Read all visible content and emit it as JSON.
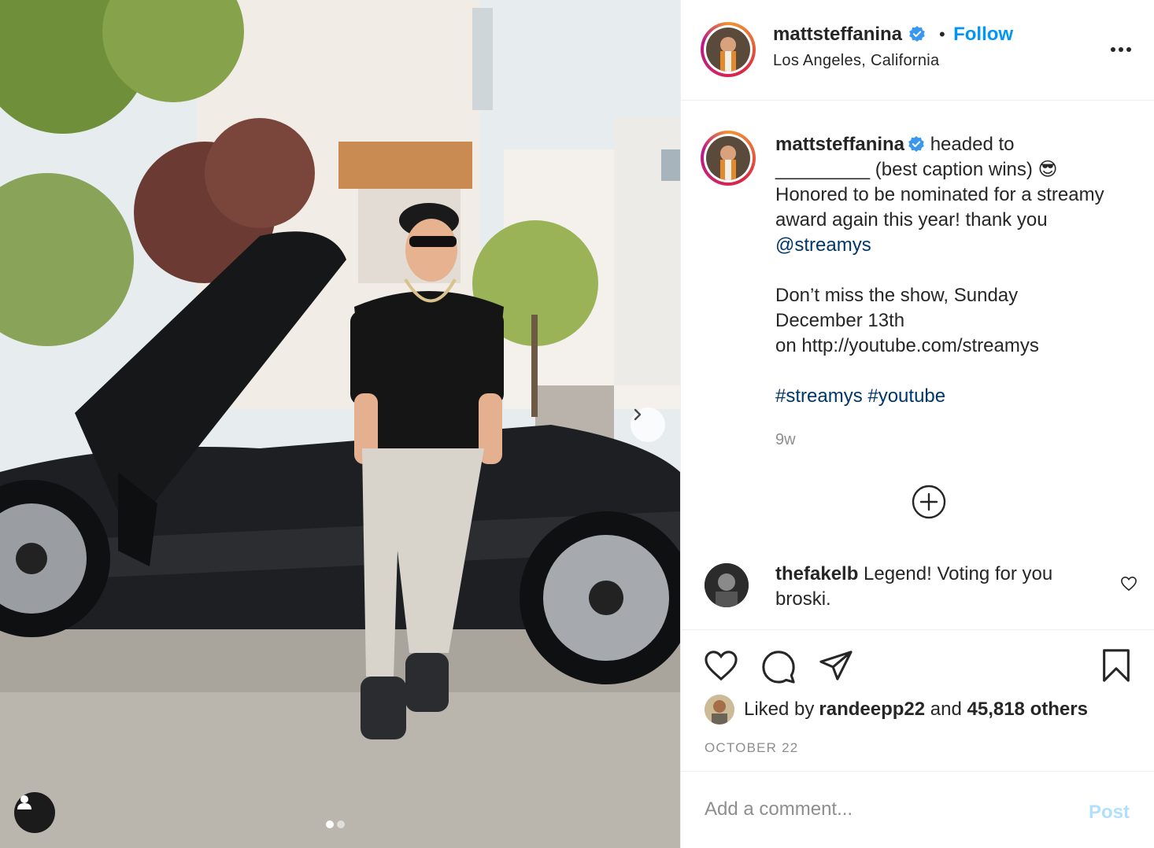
{
  "photo": {
    "alt_subject": "man-with-car-photo",
    "carousel_dots": 2,
    "active_dot": 0
  },
  "header": {
    "username": "mattsteffanina",
    "separator": "•",
    "follow_label": "Follow",
    "location": "Los Angeles, California"
  },
  "caption": {
    "username": "mattsteffanina",
    "text_1": " headed to\n_________ (best caption wins) 😎\nHonored to be nominated for a streamy award again this year! thank you ",
    "mention": "@streamys",
    "text_2": "\n\nDon’t miss the show, Sunday\nDecember 13th\non http://youtube.com/streamys\n\n",
    "hashtags": "#streamys #youtube",
    "time": "9w"
  },
  "comment": {
    "username": "thefakelb",
    "text": " Legend! Voting for you broski."
  },
  "likes": {
    "prefix": "Liked by ",
    "user": "randeepp22",
    "middle": " and ",
    "count_text": "45,818 others"
  },
  "date": "OCTOBER 22",
  "add_comment": {
    "placeholder": "Add a comment...",
    "post_label": "Post"
  },
  "colors": {
    "accent": "#0095f6",
    "link": "#00376b",
    "muted": "#8e8e8e",
    "post_disabled": "#b2dffc"
  }
}
